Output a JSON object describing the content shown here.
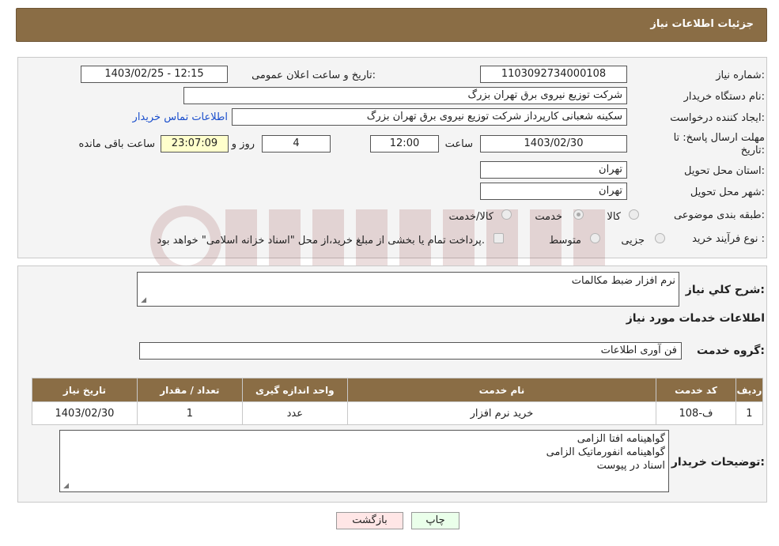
{
  "header": {
    "title": "جزئیات اطلاعات نیاز"
  },
  "form": {
    "need_number_label": "شماره نیاز:",
    "need_number": "1103092734000108",
    "announce_label": "تاریخ و ساعت اعلان عمومی:",
    "announce_value": "1403/02/25 - 12:15",
    "buyer_org_label": "نام دستگاه خریدار:",
    "buyer_org": "شرکت توزیع نیروی برق تهران بزرگ",
    "creator_label": "ایجاد کننده درخواست:",
    "creator": "سکینه شعبانی کارپرداز شرکت توزیع نیروی برق تهران بزرگ",
    "contact_link": "اطلاعات تماس خریدار",
    "deadline_label_1": "مهلت ارسال پاسخ: تا",
    "deadline_label_2": "تاریخ:",
    "deadline_date": "1403/02/30",
    "time_label": "ساعت",
    "deadline_time": "12:00",
    "days_value": "4",
    "days_label": "روز و",
    "remaining_time": "23:07:09",
    "remaining_label": "ساعت باقی مانده",
    "province_label": "استان محل تحویل:",
    "province": "تهران",
    "city_label": "شهر محل تحویل:",
    "city": "تهران",
    "category_label": "طبقه بندی موضوعی:",
    "category_options": [
      "کالا",
      "خدمت",
      "کالا/خدمت"
    ],
    "category_selected": "خدمت",
    "process_label": "نوع فرآیند خرید :",
    "process_options": [
      "جزیی",
      "متوسط"
    ],
    "payment_note": "پرداخت تمام یا بخشی از مبلغ خرید،از محل \"اسناد خزانه اسلامی\" خواهد بود."
  },
  "details": {
    "summary_label": "شرح کلي نياز:",
    "summary": "نرم افزار ضبط مکالمات",
    "services_heading": "اطلاعات خدمات مورد نياز",
    "service_group_label": "گروه خدمت:",
    "service_group": "فن آوری اطلاعات",
    "table_headers": [
      "رديف",
      "کد خدمت",
      "نام خدمت",
      "واحد اندازه گيری",
      "تعداد / مقدار",
      "تاريخ نياز"
    ],
    "table_rows": [
      [
        "1",
        "ف-108",
        "خرید نرم افزار",
        "عدد",
        "1",
        "1403/02/30"
      ]
    ],
    "buyer_notes_label": "توضيحات خريدار:",
    "buyer_notes": [
      "گواهینامه افتا الزامی",
      "گواهینامه انفورماتیک الزامی",
      "اسناد در پیوست"
    ]
  },
  "buttons": {
    "print": "چاپ",
    "back": "بازگشت"
  },
  "colors": {
    "header": "#8a6d45",
    "link": "#1a4ecc",
    "print_button": "#eaffea",
    "back_button": "#ffe6e6"
  }
}
